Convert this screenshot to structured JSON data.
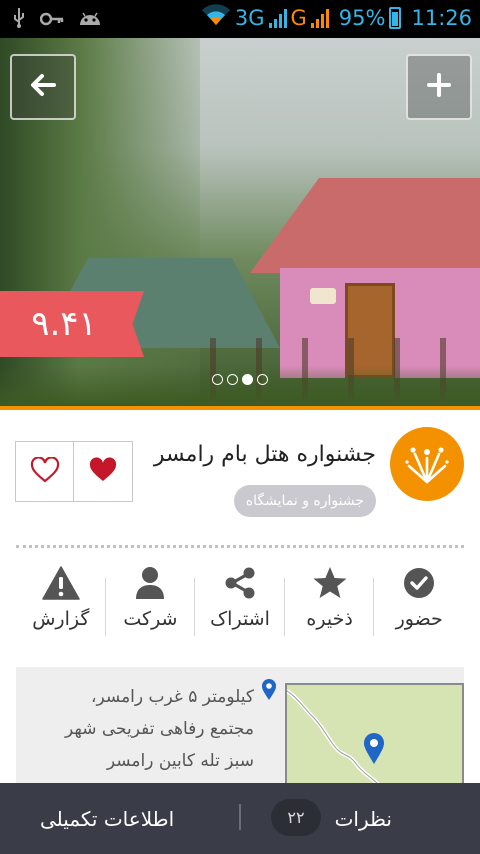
{
  "status_bar": {
    "network_type": "3G",
    "second_network": "G",
    "battery": "95%",
    "time": "11:26",
    "icons": [
      "usb-icon",
      "key-icon",
      "android-icon",
      "wifi-icon",
      "signal-icon",
      "battery-icon"
    ]
  },
  "hero": {
    "rating": "۹.۴۱",
    "slides_total": 4,
    "slide_active": 3,
    "back_icon": "arrow-left-icon",
    "add_icon": "plus-icon"
  },
  "event": {
    "title": "جشنواره هتل بام رامسر",
    "category": "جشنواره و نمایشگاه",
    "category_icon": "fireworks-icon"
  },
  "actions": [
    {
      "label": "حضور",
      "icon": "check-circle-icon"
    },
    {
      "label": "ذخیره",
      "icon": "star-icon"
    },
    {
      "label": "اشتراک",
      "icon": "share-icon"
    },
    {
      "label": "شرکت",
      "icon": "user-icon"
    },
    {
      "label": "گزارش",
      "icon": "warning-icon"
    }
  ],
  "address": {
    "lines": [
      "کیلومتر ۵ غرب رامسر،",
      "مجتمع رفاهی تفریحی شهر",
      "سبز تله کابین رامسر"
    ]
  },
  "bottom_bar": {
    "comments_label": "نظرات",
    "comments_count": "۲۲",
    "more_info_label": "اطلاعات تکمیلی"
  },
  "colors": {
    "accent_orange": "#f39100",
    "rating_red": "#e8585d",
    "heart_red": "#c4182a",
    "status_blue": "#33b5e5",
    "bottom_bar": "#3a3d47",
    "action_icon": "#555555"
  }
}
